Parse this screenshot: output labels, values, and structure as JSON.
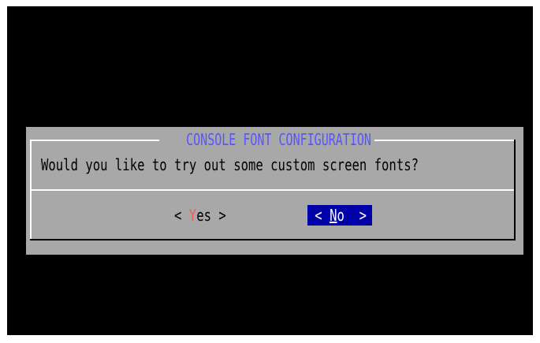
{
  "dialog": {
    "title": "CONSOLE FONT CONFIGURATION",
    "message": "Would you like to try out some custom screen fonts?"
  },
  "buttons": {
    "yes": {
      "left_bracket": "< ",
      "hotkey": "Y",
      "rest": "es",
      "right_bracket": " >"
    },
    "no": {
      "left_bracket": "< ",
      "hotkey": "N",
      "rest": "o",
      "right_bracket": "  >",
      "selected": true
    }
  },
  "colors": {
    "screen_background": "#000000",
    "dialog_background": "#a8a8a8",
    "title_text": "#5656fe",
    "hotkey_text": "#fe5454",
    "selected_button_background": "#0000a8",
    "selected_button_text": "#ffffff"
  }
}
